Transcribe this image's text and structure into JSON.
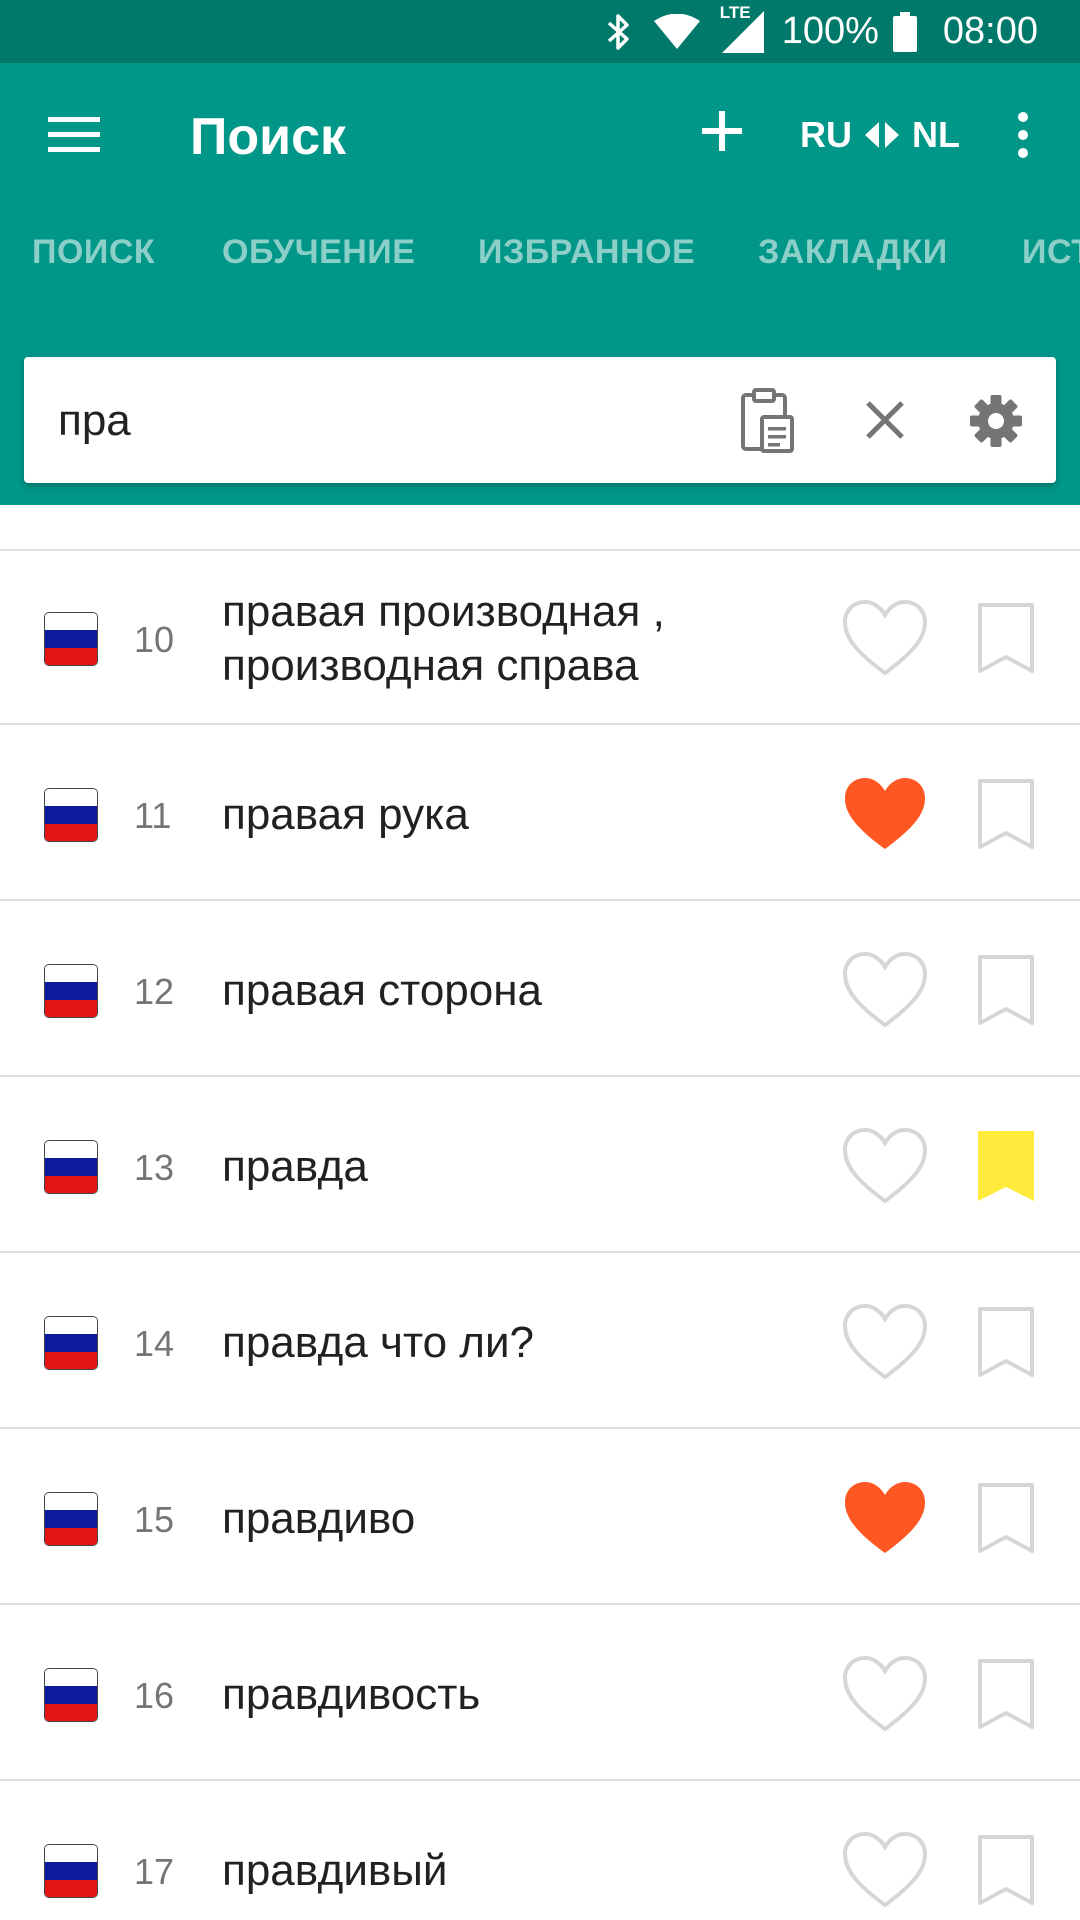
{
  "status": {
    "battery_text": "100%",
    "time": "08:00",
    "network": "LTE"
  },
  "appbar": {
    "title": "Поиск",
    "lang_from": "RU",
    "lang_to": "NL",
    "tabs": [
      {
        "label": "ПОИСК",
        "active": true
      },
      {
        "label": "ОБУЧЕНИЕ",
        "active": false
      },
      {
        "label": "ИЗБРАННОЕ",
        "active": false
      },
      {
        "label": "ЗАКЛАДКИ",
        "active": false
      },
      {
        "label": "ИСТОРИЯ",
        "active": false
      }
    ]
  },
  "search": {
    "value": "пра"
  },
  "results": [
    {
      "num": "10",
      "lines": [
        "правая производная ,",
        "производная справа"
      ],
      "favorite": false,
      "bookmarked": false
    },
    {
      "num": "11",
      "lines": [
        "правая рука"
      ],
      "favorite": true,
      "bookmarked": false
    },
    {
      "num": "12",
      "lines": [
        "правая сторона"
      ],
      "favorite": false,
      "bookmarked": false
    },
    {
      "num": "13",
      "lines": [
        "правда"
      ],
      "favorite": false,
      "bookmarked": true
    },
    {
      "num": "14",
      "lines": [
        "правда что ли?"
      ],
      "favorite": false,
      "bookmarked": false
    },
    {
      "num": "15",
      "lines": [
        "правдиво"
      ],
      "favorite": true,
      "bookmarked": false
    },
    {
      "num": "16",
      "lines": [
        "правдивость"
      ],
      "favorite": false,
      "bookmarked": false
    },
    {
      "num": "17",
      "lines": [
        "правдивый"
      ],
      "favorite": false,
      "bookmarked": false
    }
  ],
  "colors": {
    "primary": "#009688",
    "primary_dark": "#00796b",
    "favorite": "#ff5722",
    "bookmark": "#ffeb3b",
    "outline": "#d6d6d6"
  },
  "icons": {
    "menu": "menu-icon",
    "add": "plus-icon",
    "swap": "swap-arrows-icon",
    "overflow": "more-vert-icon",
    "paste": "clipboard-icon",
    "clear": "close-icon",
    "settings": "gear-icon",
    "flag": "russian-flag-icon",
    "favorite": "heart-icon",
    "bookmark": "bookmark-icon"
  }
}
